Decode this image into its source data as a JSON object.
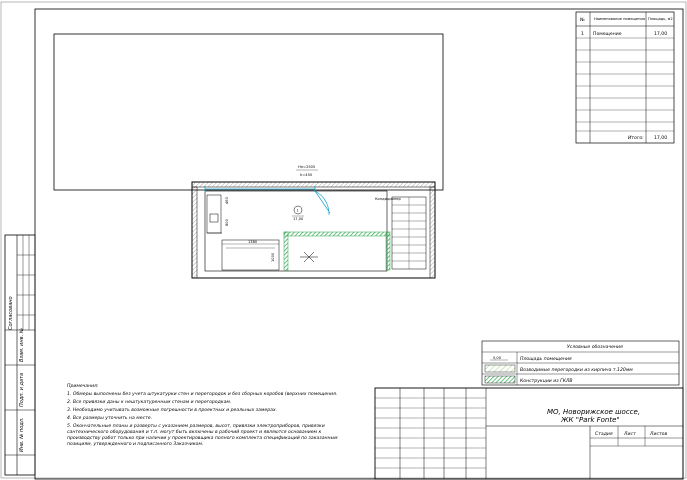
{
  "spec_table": {
    "headers": {
      "num": "№",
      "name": "Наименование помещения",
      "area": "Площадь, м2"
    },
    "rows": [
      {
        "num": "1",
        "name": "Помещение",
        "area": "17,00"
      }
    ],
    "total_label": "Итого:",
    "total_value": "17,00"
  },
  "plan": {
    "height_label": "Hп=2505",
    "h_label": "h=450",
    "room_number": "1",
    "room_area": "17,00",
    "conditioner_label": "Кондиционер",
    "dims": [
      "463",
      "800",
      "1380",
      "1000"
    ]
  },
  "legend": {
    "title": "Условные обозначения",
    "items": [
      {
        "sample": "0,00",
        "text": "Площадь помещения"
      },
      {
        "sample": "",
        "text": "Возводимые перегородки из кирпича т.120мм"
      },
      {
        "sample": "",
        "text": "Конструкции из ГКЛВ"
      }
    ]
  },
  "notes": {
    "title": "Примечания:",
    "lines": [
      "1. Обмеры выполнены без учета штукатурки стен и перегородок и без сборных коробов (верхних помещения.",
      "2. Все привязки даны к нештукатуренным стенам и перегородкам.",
      "3. Необходимо учитывать возможные погрешности в проектных и реальных замерах.",
      "4. Все размеры уточнить на месте.",
      "5. Окончательные планы и разверты с указанием размеров, высот, привязки электроприборов, привязки",
      "сантехнического оборудования и т.п. могут быть включены в рабочий проект и являются основанием к",
      "производству работ только при наличии у проектировщика полного комплекта спецификаций по заказанным",
      "позициям, утвержденного и подписанного Заказчиком."
    ]
  },
  "title_block": {
    "address_line1": "МО, Новорижское шоссе,",
    "address_line2": "ЖК \"Park Fonte\"",
    "stage": "Стадия",
    "sheet": "Лист",
    "sheets": "Листов"
  },
  "side_stamp": {
    "agreed": "Согласовано",
    "inv_sub": "Взам. инв. №",
    "sign_date": "Подп. и дата",
    "inv_orig": "Инв. № подл."
  },
  "colors": {
    "hatch_green": "#2fa84f",
    "partition_green": "#b6e3a0",
    "dim_cyan": "#1aa3c7"
  }
}
